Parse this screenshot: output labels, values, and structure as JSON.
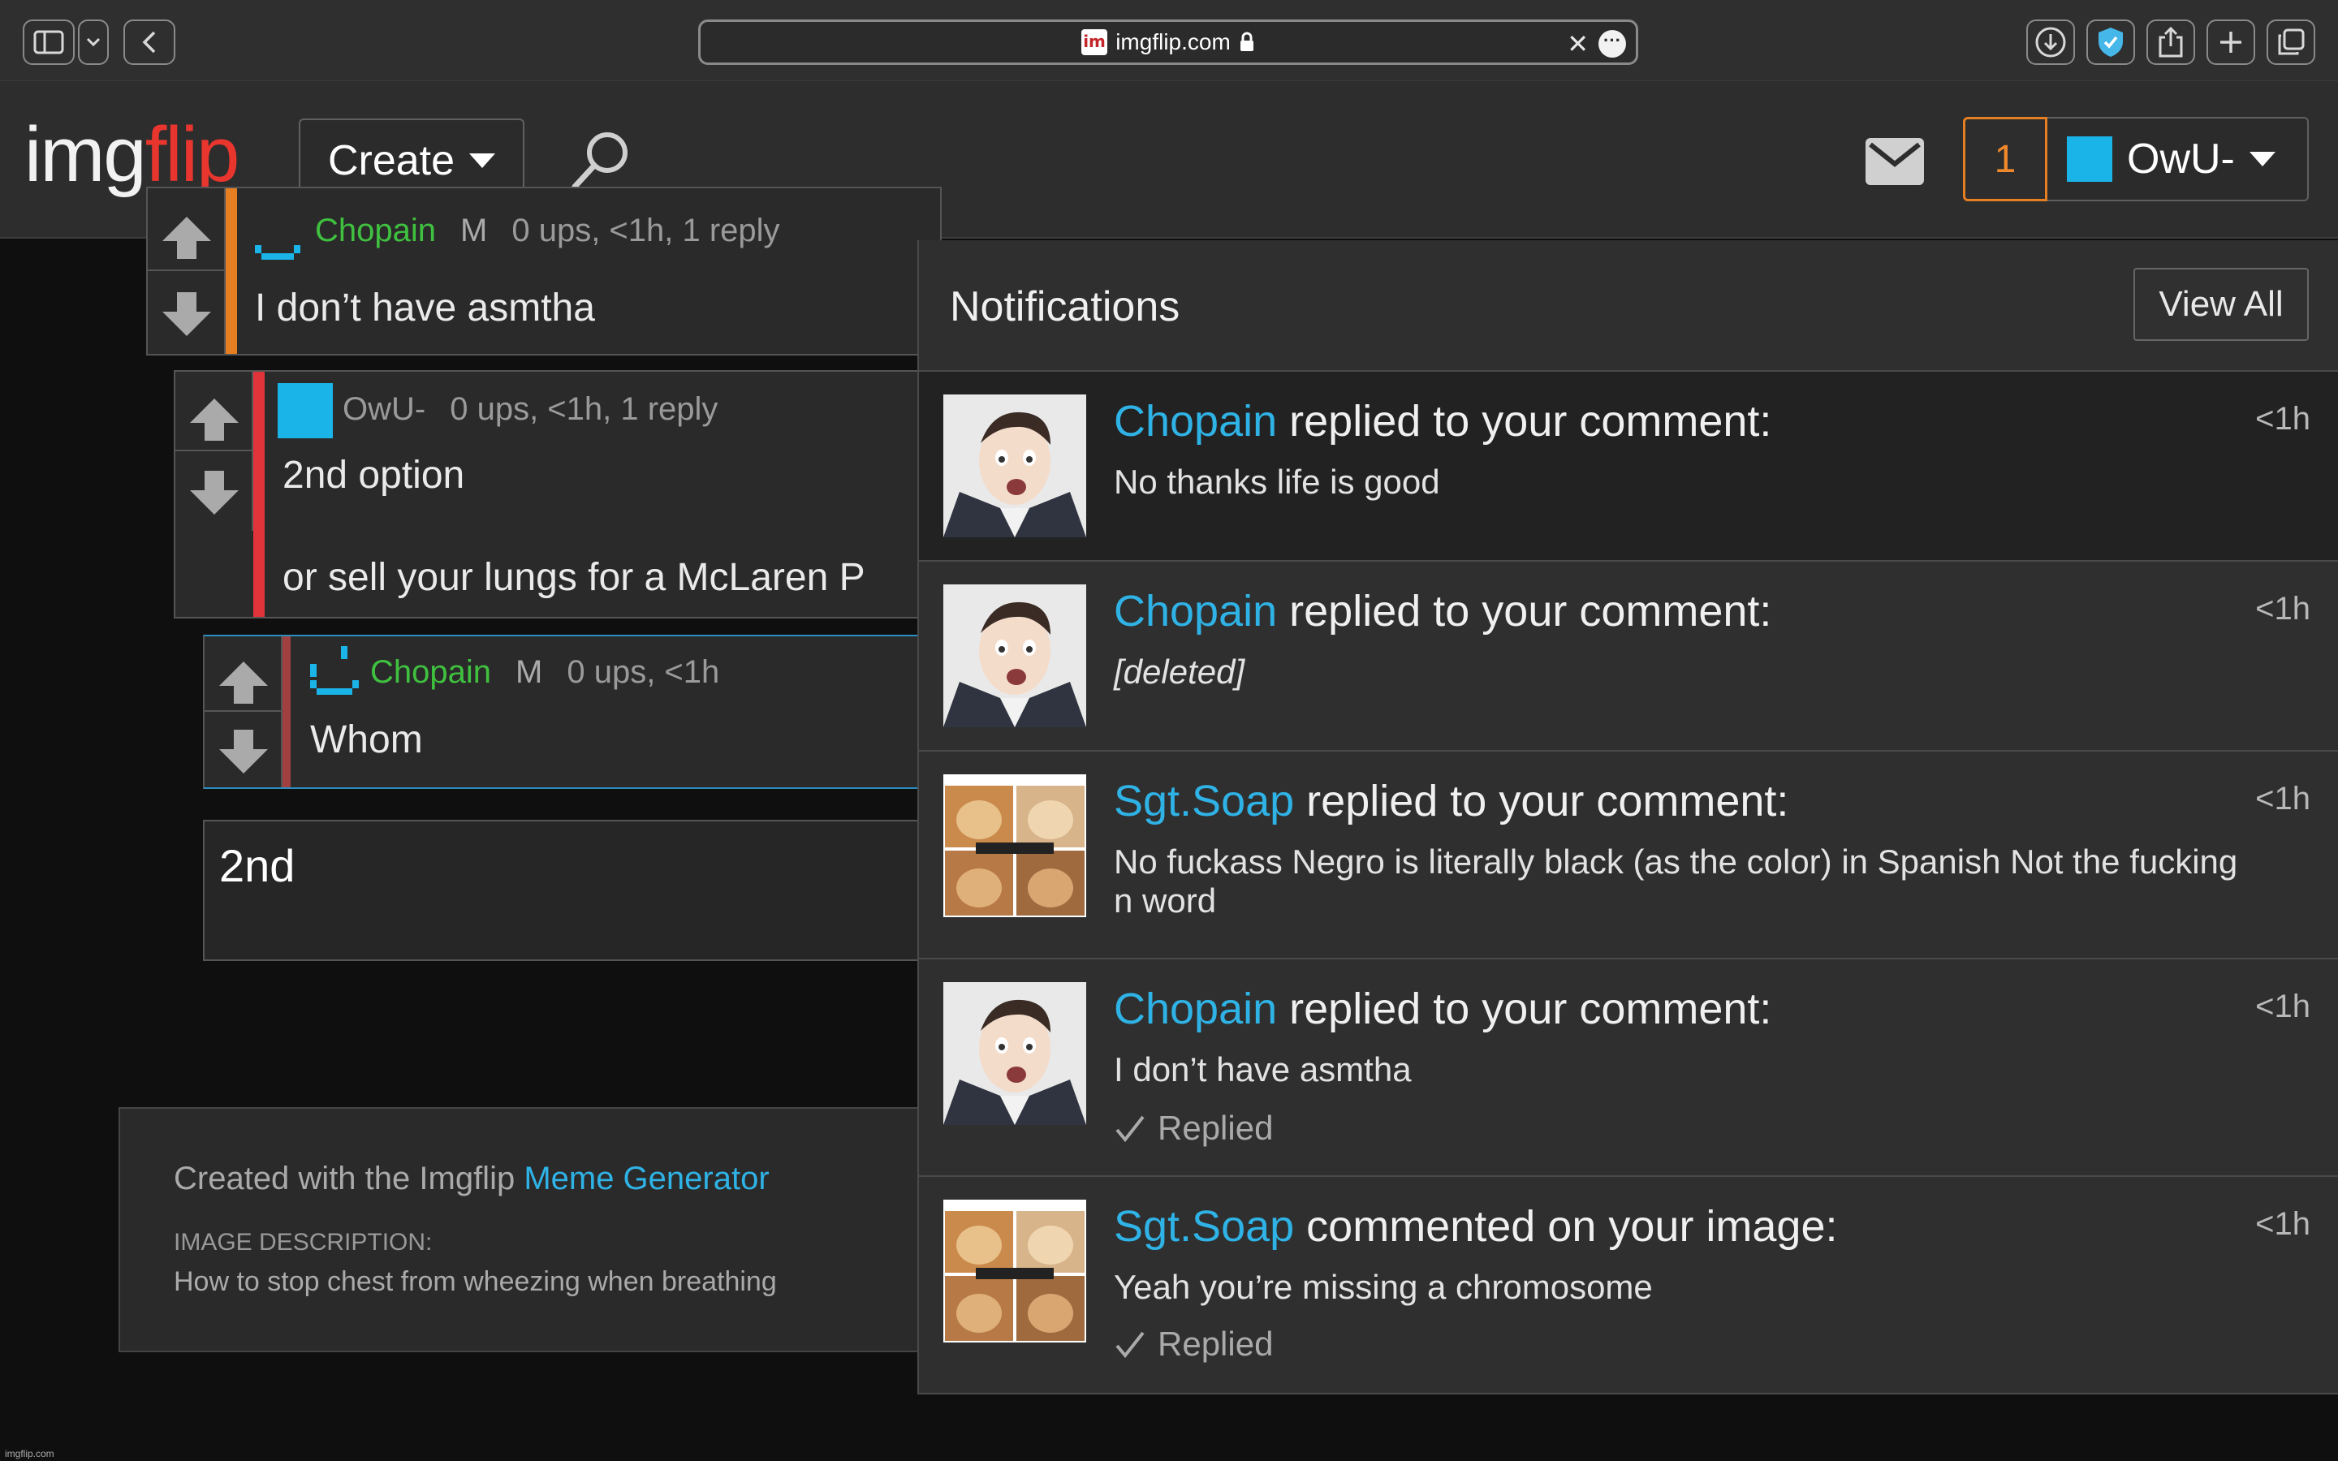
{
  "browser": {
    "url": "imgflip.com",
    "lock": "🔒"
  },
  "header": {
    "logo_img": "img",
    "logo_flip": "flip",
    "create_label": "Create",
    "notif_count": "1",
    "username": "OwU-"
  },
  "comments": [
    {
      "author": "Chopain",
      "mod": "M",
      "stats": "0 ups, <1h, 1 reply",
      "text": "I don’t have asmtha"
    },
    {
      "author": "OwU-",
      "stats": "0 ups, <1h, 1 reply",
      "text": "2nd option",
      "text2": "or sell your lungs for a McLaren P"
    },
    {
      "author": "Chopain",
      "mod": "M",
      "stats": "0 ups, <1h",
      "text": "Whom"
    }
  ],
  "reply_box": {
    "text": "2nd"
  },
  "footer": {
    "made_prefix": "Created with the Imgflip ",
    "made_link": "Meme Generator",
    "desc_label": "IMAGE DESCRIPTION:",
    "desc_text": "How to stop chest from wheezing when breathing",
    "watermark": "imgflip.com"
  },
  "notifications": {
    "title": "Notifications",
    "view_all": "View All",
    "items": [
      {
        "who": "Chopain",
        "action": " replied to your comment:",
        "time": "<1h",
        "body": "No thanks life is good",
        "thumb": "face"
      },
      {
        "who": "Chopain",
        "action": " replied to your comment:",
        "time": "<1h",
        "body": "[deleted]",
        "thumb": "face"
      },
      {
        "who": "Sgt.Soap",
        "action": " replied to your comment:",
        "time": "<1h",
        "body": "No fuckass Negro is literally black (as the color) in Spanish Not the fucking n word",
        "thumb": "hamster"
      },
      {
        "who": "Chopain",
        "action": " replied to your comment:",
        "time": "<1h",
        "body": "I don’t have asmtha",
        "replied": "Replied",
        "thumb": "face"
      },
      {
        "who": "Sgt.Soap",
        "action": " commented on your image:",
        "time": "<1h",
        "body": "Yeah you’re missing a chromosome",
        "replied": "Replied",
        "thumb": "hamster"
      }
    ]
  },
  "colors": {
    "accent_blue": "#2fb3e6",
    "accent_orange": "#e67e22",
    "author_green": "#3fc13f",
    "logo_red": "#e8362f"
  }
}
